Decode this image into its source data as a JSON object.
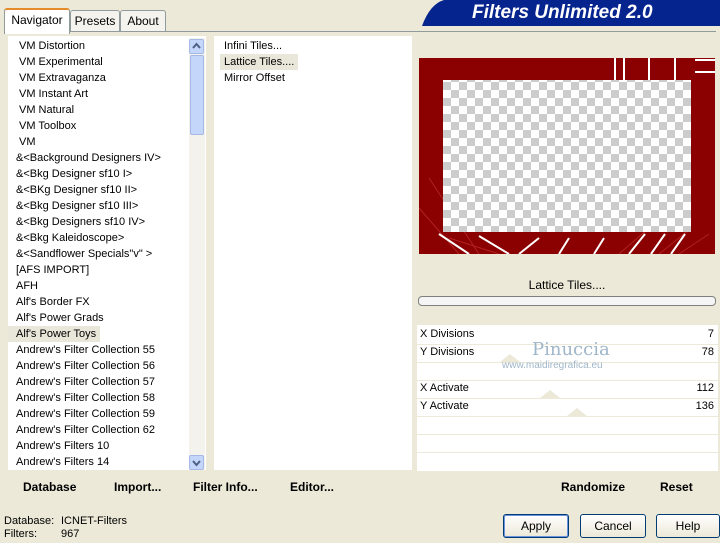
{
  "header": {
    "title": "Filters Unlimited 2.0"
  },
  "tabs": [
    {
      "label": "Navigator",
      "active": true
    },
    {
      "label": "Presets",
      "active": false
    },
    {
      "label": "About",
      "active": false
    }
  ],
  "categories": [
    "VM Distortion",
    "VM Experimental",
    "VM Extravaganza",
    "VM Instant Art",
    "VM Natural",
    "VM Toolbox",
    "VM",
    "&<Background Designers IV>",
    "&<Bkg Designer sf10 I>",
    "&<BKg Designer sf10 II>",
    "&<Bkg Designer sf10 III>",
    "&<Bkg Designers sf10 IV>",
    "&<Bkg Kaleidoscope>",
    "&<Sandflower Specials\"v\" >",
    "[AFS IMPORT]",
    "AFH",
    "Alf's Border FX",
    "Alf's Power Grads",
    "Alf's Power Toys",
    "Andrew's Filter Collection 55",
    "Andrew's Filter Collection 56",
    "Andrew's Filter Collection 57",
    "Andrew's Filter Collection 58",
    "Andrew's Filter Collection 59",
    "Andrew's Filter Collection 62",
    "Andrew's Filters 10",
    "Andrew's Filters 14"
  ],
  "selected_category_index": 18,
  "filters": [
    "Infini Tiles...",
    "Lattice Tiles....",
    "Mirror Offset"
  ],
  "selected_filter_index": 1,
  "preview": {
    "filter_name": "Lattice Tiles....",
    "progress": 0
  },
  "watermark": {
    "name": "Pinuccia",
    "url": "www.maidiregrafica.eu"
  },
  "params": [
    {
      "label": "X Divisions",
      "value": "7"
    },
    {
      "label": "Y Divisions",
      "value": "78"
    },
    {
      "label": "X Activate",
      "value": "112"
    },
    {
      "label": "Y Activate",
      "value": "136"
    }
  ],
  "bottom_left_buttons": {
    "database": "Database",
    "import": "Import...",
    "filter_info": "Filter Info...",
    "editor": "Editor..."
  },
  "bottom_right_buttons": {
    "randomize": "Randomize",
    "reset": "Reset"
  },
  "status": {
    "database_label": "Database:",
    "database_value": "ICNET-Filters",
    "filters_label": "Filters:",
    "filters_value": "967"
  },
  "dialog_buttons": {
    "apply": "Apply",
    "cancel": "Cancel",
    "help": "Help"
  },
  "colors": {
    "accent_tab": "#e68b2c",
    "title_bar": "#06248e",
    "preview_red": "#8b0000"
  }
}
